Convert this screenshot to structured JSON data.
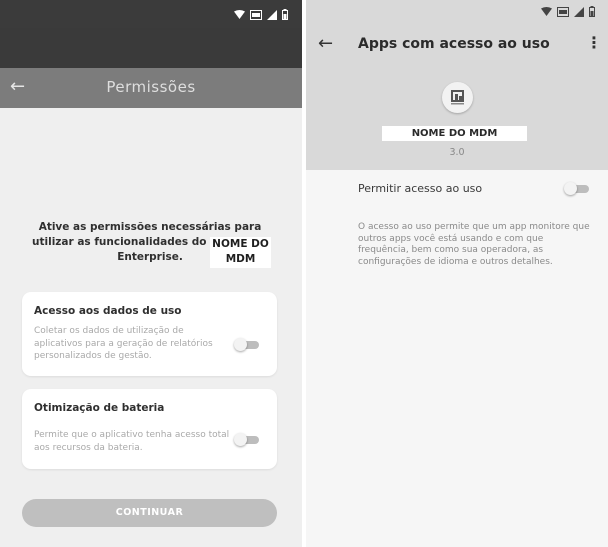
{
  "left_screen": {
    "status_bar": {
      "icons": [
        "wifi-icon",
        "sim-icon",
        "signal-icon",
        "battery-icon"
      ]
    },
    "header": {
      "back_icon": "arrow-left-icon",
      "title": "Permissões"
    },
    "intro": {
      "text": "Ative as permissões necessárias para utilizar as funcionalidades do aplicativo Enterprise.",
      "app_name": "NOME DO MDM"
    },
    "cards": [
      {
        "title": "Acesso aos dados de uso",
        "description": "Coletar os dados de utilização de aplicativos para a geração de relatórios personalizados de gestão.",
        "toggle_on": false
      },
      {
        "title": "Otimização de bateria",
        "description": "Permite que o aplicativo tenha acesso total aos recursos da bateria.",
        "toggle_on": false
      }
    ],
    "continue_button": "CONTINUAR"
  },
  "right_screen": {
    "status_bar": {
      "icons": [
        "wifi-icon",
        "sim-icon",
        "signal-icon",
        "battery-icon"
      ]
    },
    "header": {
      "back_icon": "arrow-left-icon",
      "title": "Apps com acesso ao uso",
      "menu_icon": "more-vert-icon"
    },
    "app": {
      "logo_icon": "mdm-logo-icon",
      "name": "NOME DO MDM",
      "version": "3.0"
    },
    "permit_label": "Permitir acesso ao uso",
    "permit_toggle_on": false,
    "description": "O acesso ao uso permite que um app monitore que outros apps você está usando e com que frequência, bem como sua operadora, as configurações de idioma e outros detalhes."
  },
  "colors": {
    "left_status_bar": "#3b3b3b",
    "left_header": "#7c7c7c",
    "left_background": "#efefef",
    "continue_button": "#bfbfbf",
    "right_top_area": "#d9d9d9"
  }
}
